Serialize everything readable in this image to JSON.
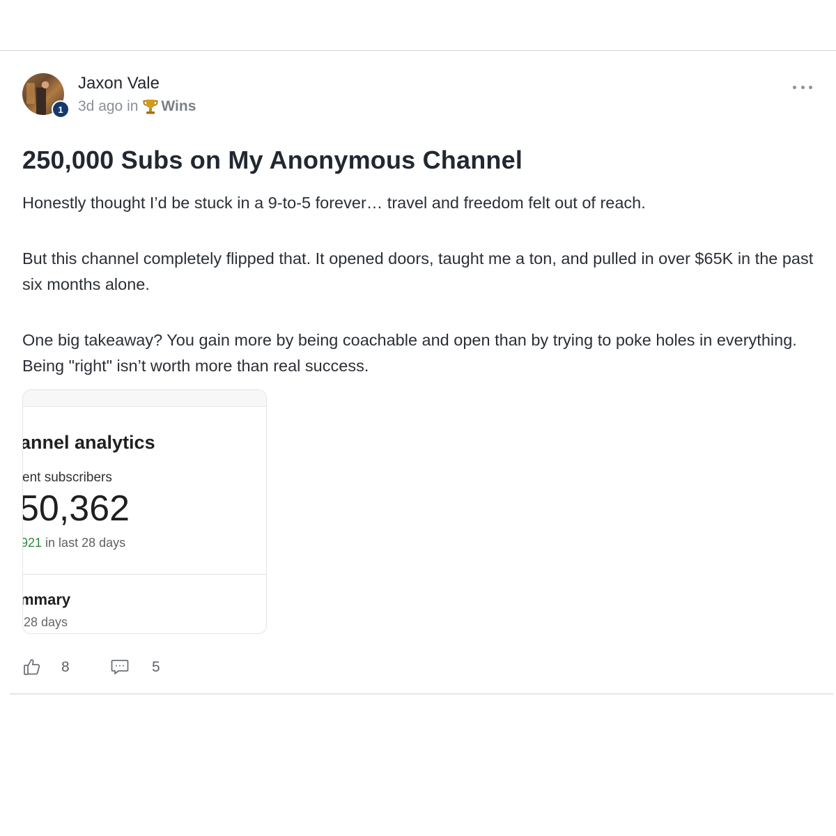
{
  "post": {
    "author": {
      "name": "Jaxon Vale",
      "level": "1",
      "avatar_icon": "profile-photo"
    },
    "meta": {
      "time_ago": "3d ago in",
      "category_icon": "trophy-icon",
      "category": "Wins"
    },
    "title": "250,000 Subs on My Anonymous Channel",
    "body": [
      "Honestly thought I’d be stuck in a 9-to-5 forever… travel and freedom felt out of reach.",
      "But this channel completely flipped that. It opened doors, taught me a ton, and pulled in over $65K in the past six months alone.",
      "One big takeaway? You gain more by being coachable and open than by trying to poke holes in everything. Being \"right\" isn’t worth more than real success."
    ],
    "attachment": {
      "title": "annel analytics",
      "subscribers_label": "ent subscribers",
      "subscribers_value": "50,362",
      "change_value": "921",
      "change_suffix": " in last 28 days",
      "summary_label": "mmary",
      "summary_period": "28 days"
    },
    "actions": {
      "likes": "8",
      "comments": "5"
    }
  },
  "colors": {
    "badge": "#16396b",
    "positive_change": "#2e8b3e",
    "muted_text": "#8a8f96"
  }
}
